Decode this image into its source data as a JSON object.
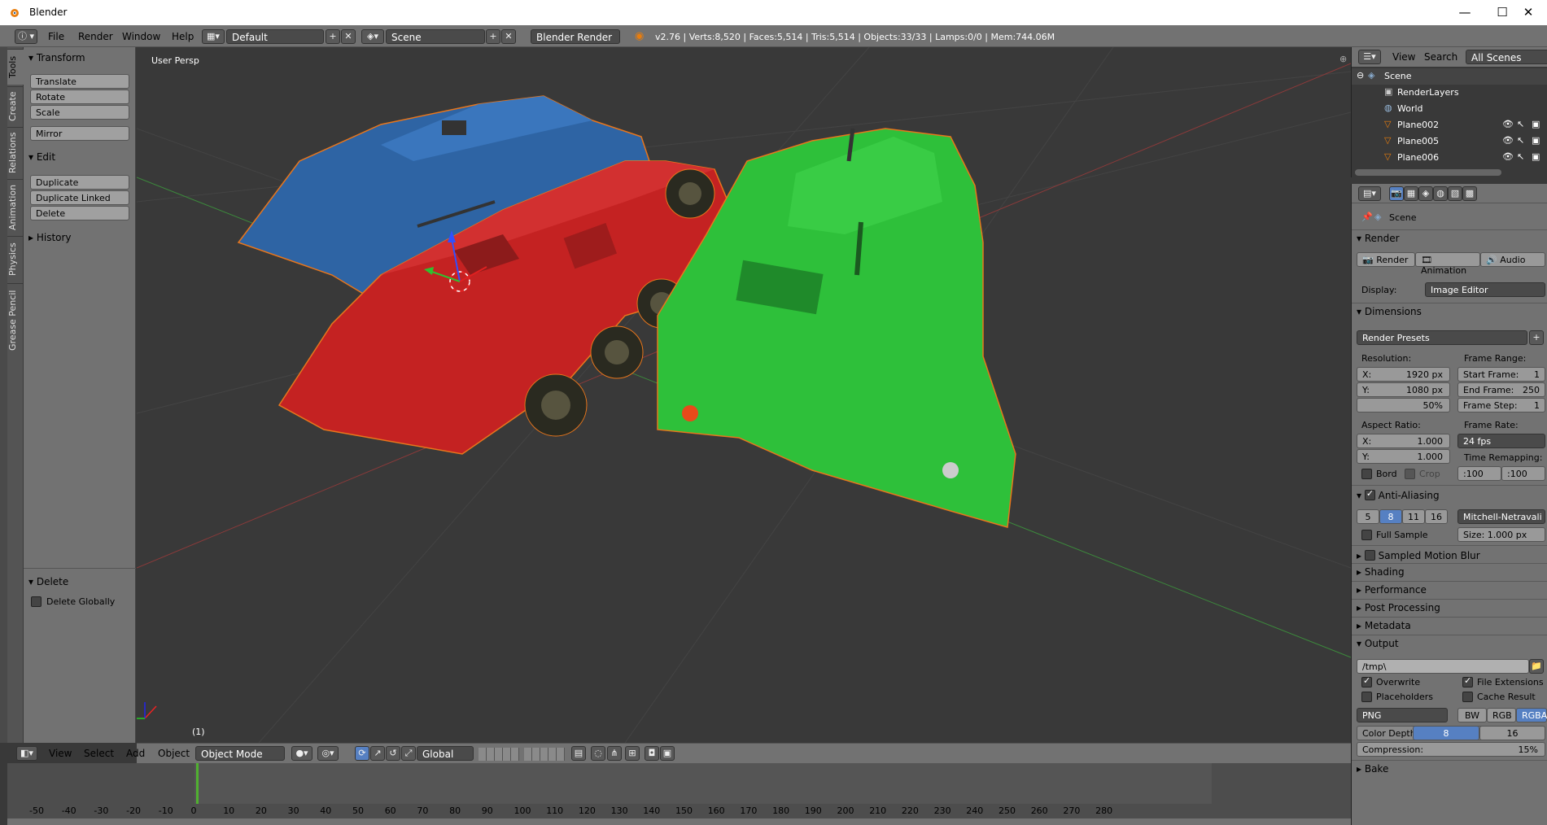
{
  "window": {
    "title": "Blender",
    "minimize": "—",
    "maximize": "☐",
    "close": "✕"
  },
  "menu": {
    "file": "File",
    "render": "Render",
    "window": "Window",
    "help": "Help"
  },
  "screen_layout": "Default",
  "scene_name": "Scene",
  "engine": "Blender Render",
  "stats": "v2.76 | Verts:8,520 | Faces:5,514 | Tris:5,514 | Objects:33/33 | Lamps:0/0 | Mem:744.06M",
  "tool_tabs": [
    "Tools",
    "Create",
    "Relations",
    "Animation",
    "Physics",
    "Grease Pencil"
  ],
  "tools": {
    "transform_title": "Transform",
    "translate": "Translate",
    "rotate": "Rotate",
    "scale": "Scale",
    "mirror": "Mirror",
    "edit_title": "Edit",
    "duplicate": "Duplicate",
    "duplicate_linked": "Duplicate Linked",
    "delete": "Delete",
    "history_title": "History",
    "delete_panel_title": "Delete",
    "delete_globally": "Delete Globally"
  },
  "viewport": {
    "view_name": "User Persp",
    "frame_label": "(1)"
  },
  "viewport_header": {
    "view": "View",
    "select": "Select",
    "add": "Add",
    "object": "Object",
    "mode": "Object Mode",
    "orientation": "Global"
  },
  "timeline": {
    "ticks": [
      "-50",
      "-40",
      "-30",
      "-20",
      "-10",
      "0",
      "10",
      "20",
      "30",
      "40",
      "50",
      "60",
      "70",
      "80",
      "90",
      "100",
      "110",
      "120",
      "130",
      "140",
      "150",
      "160",
      "170",
      "180",
      "190",
      "200",
      "210",
      "220",
      "230",
      "240",
      "250",
      "260",
      "270",
      "280"
    ]
  },
  "outliner": {
    "view": "View",
    "search": "Search",
    "filter": "All Scenes",
    "items": [
      "Scene",
      "RenderLayers",
      "World",
      "Plane002",
      "Plane005",
      "Plane006"
    ]
  },
  "properties": {
    "context": "Scene",
    "render_title": "Render",
    "render_btn": "Render",
    "animation_btn": "Animation",
    "audio_btn": "Audio",
    "display_label": "Display:",
    "display_value": "Image Editor",
    "dimensions_title": "Dimensions",
    "render_presets": "Render Presets",
    "resolution_label": "Resolution:",
    "res_x": "X:",
    "res_x_val": "1920 px",
    "res_y": "Y:",
    "res_y_val": "1080 px",
    "res_pct": "50%",
    "frame_range_label": "Frame Range:",
    "start_frame": "Start Frame:",
    "start_frame_val": "1",
    "end_frame": "End Frame:",
    "end_frame_val": "250",
    "frame_step": "Frame Step:",
    "frame_step_val": "1",
    "aspect_label": "Aspect Ratio:",
    "aspect_x": "X:",
    "aspect_x_val": "1.000",
    "aspect_y": "Y:",
    "aspect_y_val": "1.000",
    "frame_rate_label": "Frame Rate:",
    "frame_rate_val": "24 fps",
    "time_remap_label": "Time Remapping:",
    "remap_old": ":100",
    "remap_new": ":100",
    "bord": "Bord",
    "crop": "Crop",
    "aa_title": "Anti-Aliasing",
    "aa_samples": [
      "5",
      "8",
      "11",
      "16"
    ],
    "aa_filter": "Mitchell-Netravali",
    "full_sample": "Full Sample",
    "size_label": "Size:",
    "size_val": "1.000 px",
    "sampled_motion_blur": "Sampled Motion Blur",
    "shading": "Shading",
    "performance": "Performance",
    "post_processing": "Post Processing",
    "metadata": "Metadata",
    "output_title": "Output",
    "output_path": "/tmp\\",
    "overwrite": "Overwrite",
    "file_extensions": "File Extensions",
    "placeholders": "Placeholders",
    "cache_result": "Cache Result",
    "format": "PNG",
    "bw": "BW",
    "rgb": "RGB",
    "rgba": "RGBA",
    "color_depth_label": "Color Depth:",
    "depth_8": "8",
    "depth_16": "16",
    "compression_label": "Compression:",
    "compression_val": "15%",
    "bake": "Bake"
  }
}
